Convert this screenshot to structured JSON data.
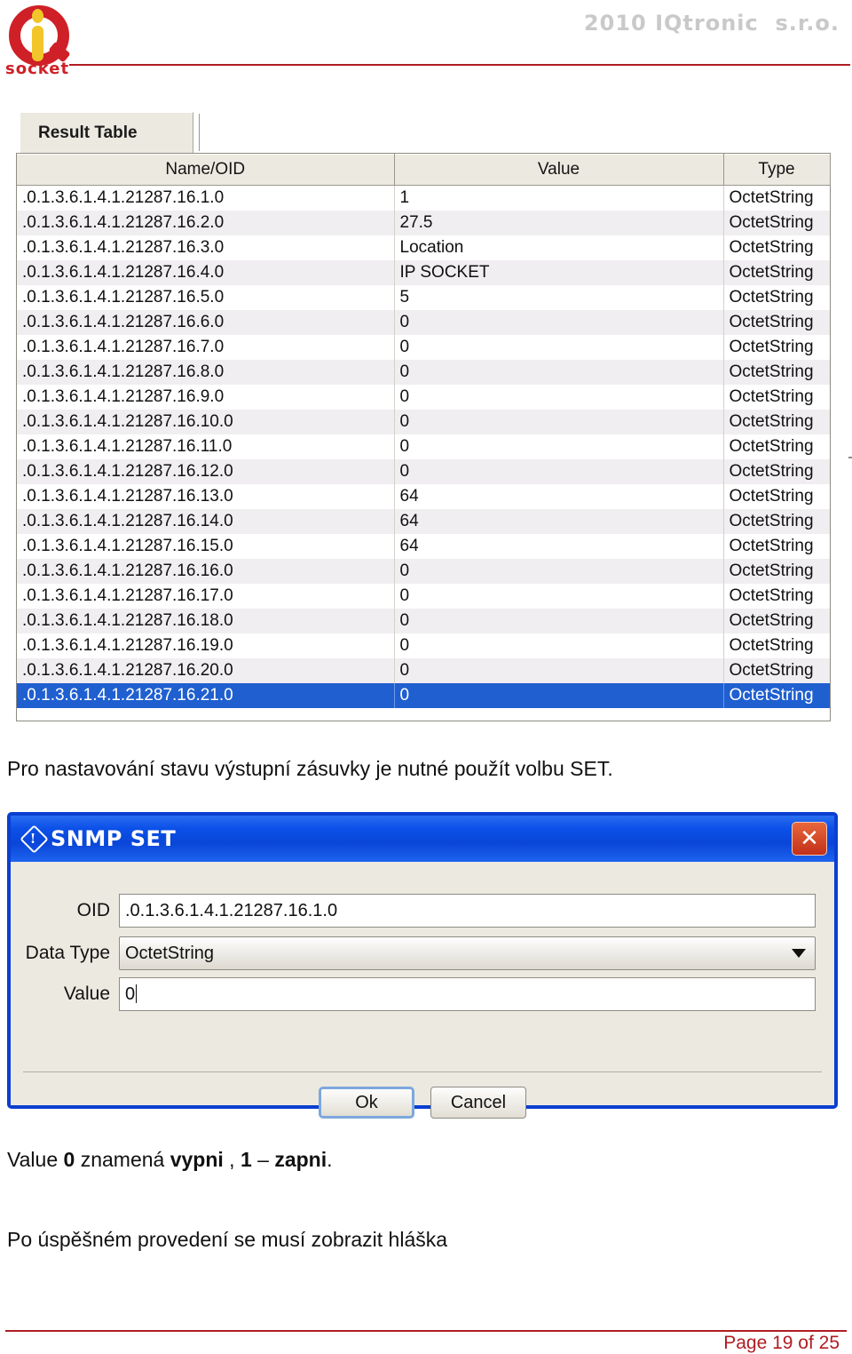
{
  "header": {
    "copyright": "2010 IQtronic  s.r.o.",
    "logo_word": "socket"
  },
  "panel": {
    "tab_label": "Result Table",
    "columns": [
      "Name/OID",
      "Value",
      "Type"
    ],
    "rows": [
      {
        "oid": ".0.1.3.6.1.4.1.21287.16.1.0",
        "value": "1",
        "type": "OctetString"
      },
      {
        "oid": ".0.1.3.6.1.4.1.21287.16.2.0",
        "value": "27.5",
        "type": "OctetString"
      },
      {
        "oid": ".0.1.3.6.1.4.1.21287.16.3.0",
        "value": "Location",
        "type": "OctetString"
      },
      {
        "oid": ".0.1.3.6.1.4.1.21287.16.4.0",
        "value": "IP SOCKET",
        "type": "OctetString"
      },
      {
        "oid": ".0.1.3.6.1.4.1.21287.16.5.0",
        "value": "5",
        "type": "OctetString"
      },
      {
        "oid": ".0.1.3.6.1.4.1.21287.16.6.0",
        "value": "0",
        "type": "OctetString"
      },
      {
        "oid": ".0.1.3.6.1.4.1.21287.16.7.0",
        "value": "0",
        "type": "OctetString"
      },
      {
        "oid": ".0.1.3.6.1.4.1.21287.16.8.0",
        "value": "0",
        "type": "OctetString"
      },
      {
        "oid": ".0.1.3.6.1.4.1.21287.16.9.0",
        "value": "0",
        "type": "OctetString"
      },
      {
        "oid": ".0.1.3.6.1.4.1.21287.16.10.0",
        "value": "0",
        "type": "OctetString"
      },
      {
        "oid": ".0.1.3.6.1.4.1.21287.16.11.0",
        "value": "0",
        "type": "OctetString"
      },
      {
        "oid": ".0.1.3.6.1.4.1.21287.16.12.0",
        "value": "0",
        "type": "OctetString"
      },
      {
        "oid": ".0.1.3.6.1.4.1.21287.16.13.0",
        "value": "64",
        "type": "OctetString"
      },
      {
        "oid": ".0.1.3.6.1.4.1.21287.16.14.0",
        "value": "64",
        "type": "OctetString"
      },
      {
        "oid": ".0.1.3.6.1.4.1.21287.16.15.0",
        "value": "64",
        "type": "OctetString"
      },
      {
        "oid": ".0.1.3.6.1.4.1.21287.16.16.0",
        "value": "0",
        "type": "OctetString"
      },
      {
        "oid": ".0.1.3.6.1.4.1.21287.16.17.0",
        "value": "0",
        "type": "OctetString"
      },
      {
        "oid": ".0.1.3.6.1.4.1.21287.16.18.0",
        "value": "0",
        "type": "OctetString"
      },
      {
        "oid": ".0.1.3.6.1.4.1.21287.16.19.0",
        "value": "0",
        "type": "OctetString"
      },
      {
        "oid": ".0.1.3.6.1.4.1.21287.16.20.0",
        "value": "0",
        "type": "OctetString"
      },
      {
        "oid": ".0.1.3.6.1.4.1.21287.16.21.0",
        "value": "0",
        "type": "OctetString",
        "selected": true
      }
    ]
  },
  "text": {
    "para1": "Pro nastavování stavu výstupní zásuvky je nutné použít volbu SET.",
    "para2_prefix": "Value ",
    "para2_b1": "0",
    "para2_mid1": " znamená ",
    "para2_b2": "vypni",
    "para2_mid2": " , ",
    "para2_b3": "1",
    "para2_mid3": " – ",
    "para2_b4": "zapni",
    "para2_suffix": ".",
    "para3": "Po úspěšném provedení se musí zobrazit hláška"
  },
  "dialog": {
    "title": "SNMP SET",
    "close_label": "✕",
    "fields": {
      "oid_label": "OID",
      "oid_value": ".0.1.3.6.1.4.1.21287.16.1.0",
      "type_label": "Data Type",
      "type_value": "OctetString",
      "value_label": "Value",
      "value_value": "0"
    },
    "ok_label": "Ok",
    "cancel_label": "Cancel"
  },
  "footer": {
    "page": "Page 19 of 25"
  },
  "colors": {
    "brand_red": "#b01c22",
    "title_blue": "#0a46d8",
    "selection_blue": "#1f5fd0"
  }
}
